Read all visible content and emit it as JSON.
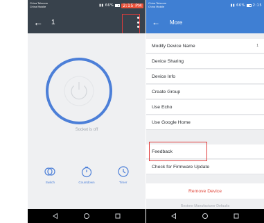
{
  "left_screen": {
    "status_bar": {
      "carrier_line1": "China Telecom",
      "carrier_line2": "China Mobile",
      "signal_text": "66%",
      "time": "2:15 PM"
    },
    "header": {
      "back_icon": "arrow-left-icon",
      "title": "1",
      "menu_icon": "more-vertical-icon"
    },
    "socket_status": "Socket is off",
    "controls": [
      {
        "icon": "toggle-icon",
        "label": "Switch"
      },
      {
        "icon": "countdown-icon",
        "label": "Countdown"
      },
      {
        "icon": "clock-icon",
        "label": "Timer"
      }
    ],
    "colors": {
      "header_bg": "#38424c",
      "accent": "#4c7fd8",
      "highlight": "#e03b3b"
    }
  },
  "right_screen": {
    "status_bar": {
      "carrier_line1": "China Telecom",
      "carrier_line2": "China Mobile",
      "signal_text": "66%",
      "time": "2:15"
    },
    "header": {
      "back_icon": "arrow-left-icon",
      "title": "More"
    },
    "menu": [
      {
        "label": "Modify Device Name",
        "value": "1"
      },
      {
        "label": "Device Sharing"
      },
      {
        "label": "Device Info"
      },
      {
        "label": "Create Group"
      },
      {
        "label": "Use Echo"
      },
      {
        "label": "Use Google Home"
      },
      {
        "label": "Feedback"
      },
      {
        "label": "Check for Firmware Update"
      }
    ],
    "remove_label": "Remove Device",
    "restore_label": "Restore Manufacturer Defaults",
    "colors": {
      "header_bg": "#3f7fd3",
      "remove": "#e0483c"
    }
  }
}
